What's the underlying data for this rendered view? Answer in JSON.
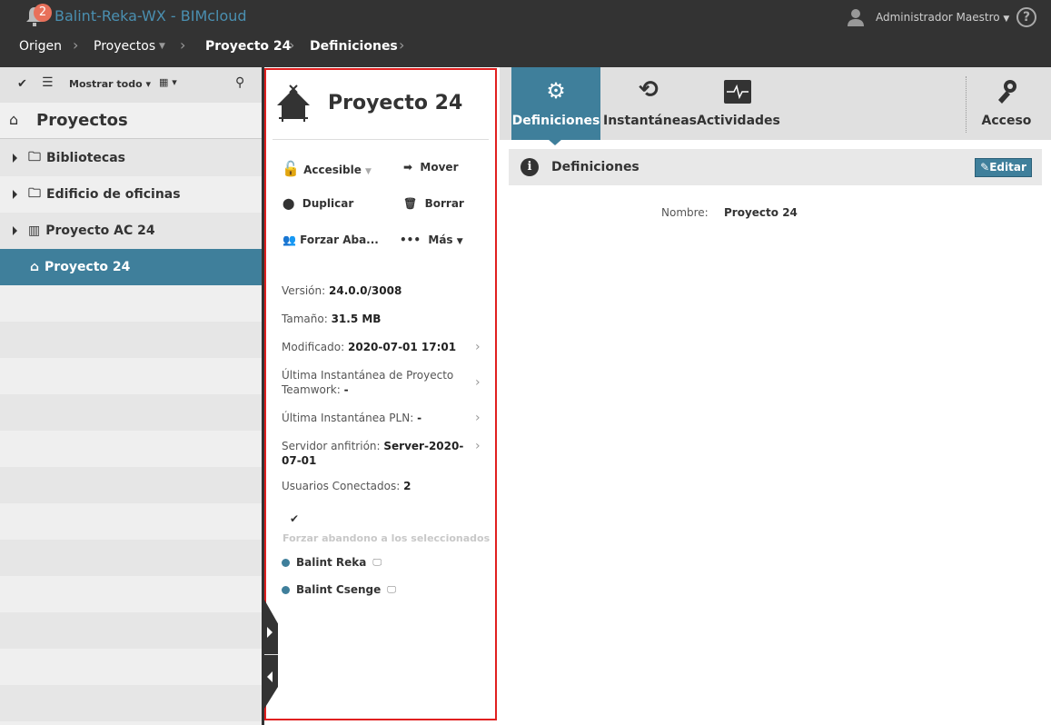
{
  "header": {
    "app_title": "Balint-Reka-WX - BIMcloud",
    "notification_count": "2",
    "user": "Administrador Maestro",
    "help": "?"
  },
  "breadcrumb": [
    "Origen",
    "Proyectos",
    "Proyecto 24",
    "Definiciones"
  ],
  "sidebar": {
    "toolbar": {
      "filter_label": "Mostrar todo"
    },
    "title": "Proyectos",
    "items": [
      {
        "label": "Bibliotecas"
      },
      {
        "label": "Edificio de oficinas"
      },
      {
        "label": "Proyecto AC 24"
      },
      {
        "label": "Proyecto 24"
      }
    ]
  },
  "panel": {
    "title": "Proyecto 24",
    "actions": {
      "accessible": "Accesible",
      "move": "Mover",
      "duplicate": "Duplicar",
      "delete": "Borrar",
      "force_leave": "Forzar Aba...",
      "more": "Más"
    },
    "info": {
      "version_label": "Versión:",
      "version": "24.0.0/3008",
      "size_label": "Tamaño:",
      "size": "31.5 MB",
      "modified_label": "Modificado:",
      "modified": "2020-07-01 17:01",
      "tw_snapshot_label": "Última Instantánea de Proyecto Teamwork:",
      "tw_snapshot": "-",
      "pln_snapshot_label": "Última Instantánea PLN:",
      "pln_snapshot": "-",
      "host_label": "Servidor anfitrión:",
      "host": "Server-2020-07-01",
      "users_label": "Usuarios Conectados:",
      "users": "2"
    },
    "force_selected": "Forzar abandono a los seleccionados",
    "users": [
      "Balint Reka",
      "Balint Csenge"
    ]
  },
  "tabs": [
    {
      "label": "Definiciones"
    },
    {
      "label": "Instantáneas"
    },
    {
      "label": "Actividades"
    },
    {
      "label": "Acceso"
    }
  ],
  "section": {
    "title": "Definiciones",
    "edit": "Editar",
    "name_label": "Nombre:",
    "name": "Proyecto 24"
  },
  "colors": {
    "accent": "#3f7f9b",
    "topbar": "#333333",
    "badge": "#e8705a"
  }
}
